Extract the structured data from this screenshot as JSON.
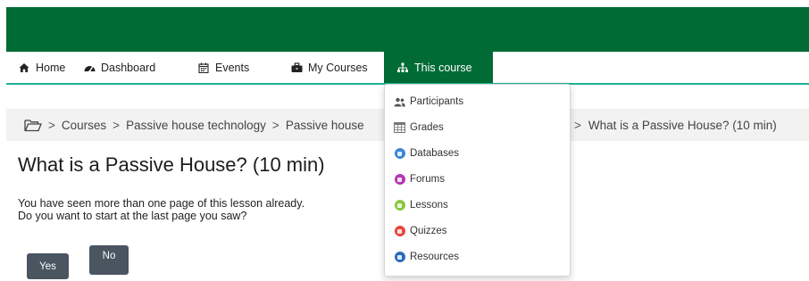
{
  "nav": {
    "items": [
      {
        "label": "Home",
        "icon": "home-icon"
      },
      {
        "label": "Dashboard",
        "icon": "dashboard-icon"
      },
      {
        "label": "Events",
        "icon": "calendar-icon"
      },
      {
        "label": "My Courses",
        "icon": "briefcase-icon"
      },
      {
        "label": "This course",
        "icon": "sitemap-icon",
        "active": true
      }
    ],
    "active_color": "#006b35",
    "accent_color": "#1ab394"
  },
  "dropdown": {
    "items": [
      {
        "label": "Participants",
        "icon": "users-icon"
      },
      {
        "label": "Grades",
        "icon": "table-icon"
      },
      {
        "label": "Databases",
        "icon": "database-icon",
        "color": "#3a86d6"
      },
      {
        "label": "Forums",
        "icon": "forum-icon",
        "color": "#b336b3"
      },
      {
        "label": "Lessons",
        "icon": "lesson-icon",
        "color": "#8cc63f"
      },
      {
        "label": "Quizzes",
        "icon": "quiz-icon",
        "color": "#e8473c"
      },
      {
        "label": "Resources",
        "icon": "resource-icon",
        "color": "#2a6bbf"
      }
    ]
  },
  "breadcrumb": {
    "items": [
      "Courses",
      "Passive house technology",
      "Passive house"
    ],
    "current": "What is a Passive House? (10 min)",
    "separator": ">"
  },
  "page": {
    "title": "What is a Passive House? (10 min)",
    "message_line1": "You have seen more than one page of this lesson already.",
    "message_line2": "Do you want to start at the last page you saw?",
    "yes_label": "Yes",
    "no_label": "No"
  },
  "colors": {
    "topbar": "#006b35",
    "button": "#4a5560"
  }
}
